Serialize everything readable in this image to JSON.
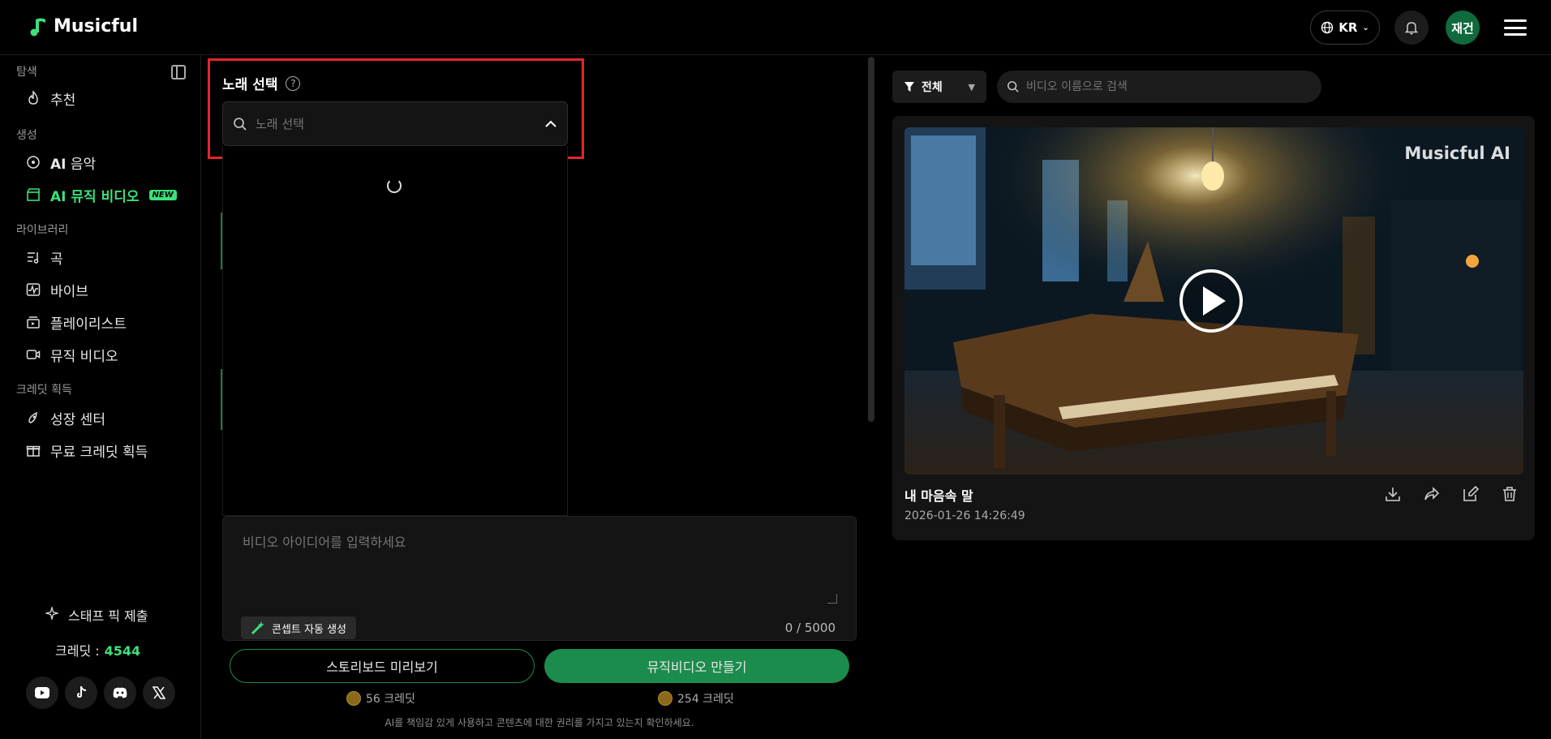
{
  "header": {
    "brand": "Musicful",
    "language": "KR",
    "avatar_initials": "재건",
    "accent_color": "#3de07b"
  },
  "sidebar": {
    "sections": {
      "explore": "탐색",
      "create": "생성",
      "library": "라이브러리",
      "earn": "크레딧 획득"
    },
    "items": {
      "recommend": "추천",
      "ai_music_bold": "AI",
      "ai_music": "음악",
      "ai_video_bold": "AI",
      "ai_video": "뮤직 비디오",
      "ai_video_badge": "NEW",
      "songs": "곡",
      "vibes": "바이브",
      "playlist": "플레이리스트",
      "music_video": "뮤직 비디오",
      "growth": "성장 센터",
      "free_credits": "무료 크레딧 획득"
    },
    "staff_pick": "스태프 픽 제출",
    "credits_label": "크레딧 :",
    "credits_value": "4544",
    "socials": [
      "youtube-icon",
      "tiktok-icon",
      "discord-icon",
      "x-icon"
    ]
  },
  "editor": {
    "song_select_title": "노래 선택",
    "song_select_placeholder": "노래 선택",
    "idea_placeholder": "비디오 아이디어를 입력하세요",
    "concept_button": "콘셉트 자동 생성",
    "counter": "0 / 5000",
    "storyboard_button": "스토리보드 미리보기",
    "make_video_button": "뮤직비디오 만들기",
    "storyboard_cost": "56 크레딧",
    "make_video_cost": "254 크레딧",
    "disclaimer": "AI를 책임감 있게 사용하고 콘텐츠에 대한 권리를 가지고 있는지 확인하세요."
  },
  "videos": {
    "filter_label": "전체",
    "search_placeholder": "비디오 이름으로 검색",
    "items": [
      {
        "watermark": "Musicful AI",
        "title": "내 마음속 말",
        "date": "2026-01-26 14:26:49"
      }
    ]
  }
}
